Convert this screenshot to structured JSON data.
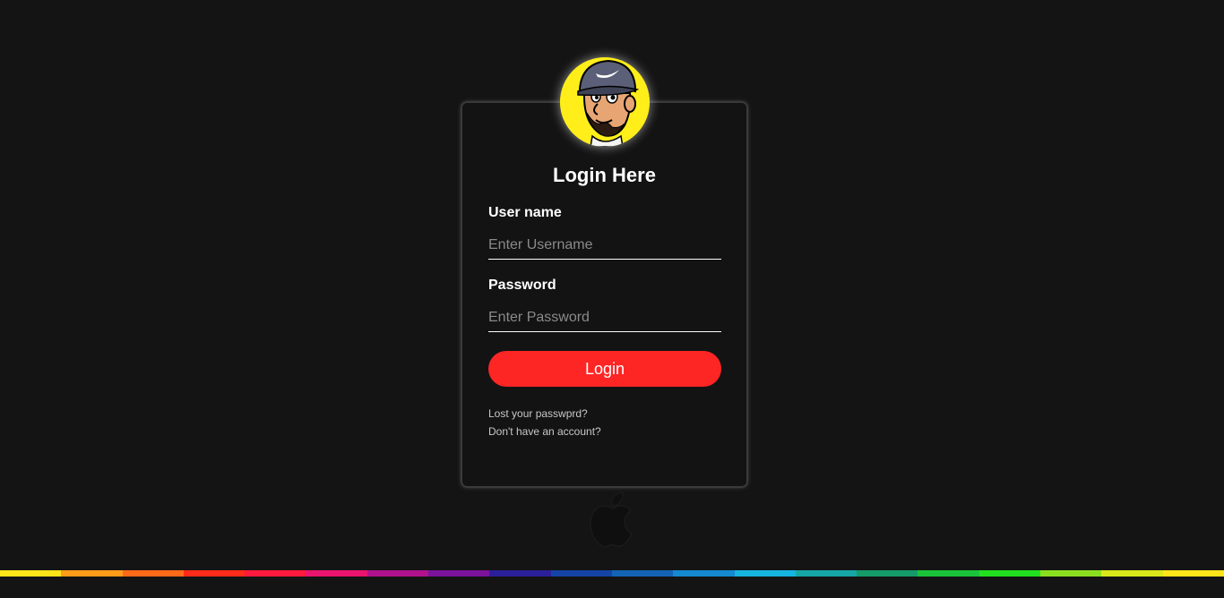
{
  "login_form": {
    "title": "Login Here",
    "username_label": "User name",
    "username_placeholder": "Enter Username",
    "username_value": "",
    "password_label": "Password",
    "password_placeholder": "Enter Password",
    "password_value": "",
    "submit_label": "Login",
    "lost_password_link": "Lost your passwprd?",
    "no_account_link": "Don't have an account?"
  },
  "icons": {
    "avatar": "cartoon-man-avatar",
    "logo": "apple-logo-icon"
  },
  "colors": {
    "background": "#141414",
    "card_background": "#131313",
    "button": "#fe2525",
    "avatar_background": "#ffee1a",
    "rainbow": [
      "#ffe41a",
      "#ff9c1a",
      "#ff6a1a",
      "#ff2b1a",
      "#ff1a3d",
      "#e8146e",
      "#b0128d",
      "#7a139a",
      "#2b1f9a",
      "#1445a6",
      "#1464b5",
      "#158ad1",
      "#16b4e0",
      "#16a6a6",
      "#159a6a",
      "#1ac33a",
      "#22e01f",
      "#8ae01f",
      "#d9e81a",
      "#ffe41a"
    ]
  }
}
